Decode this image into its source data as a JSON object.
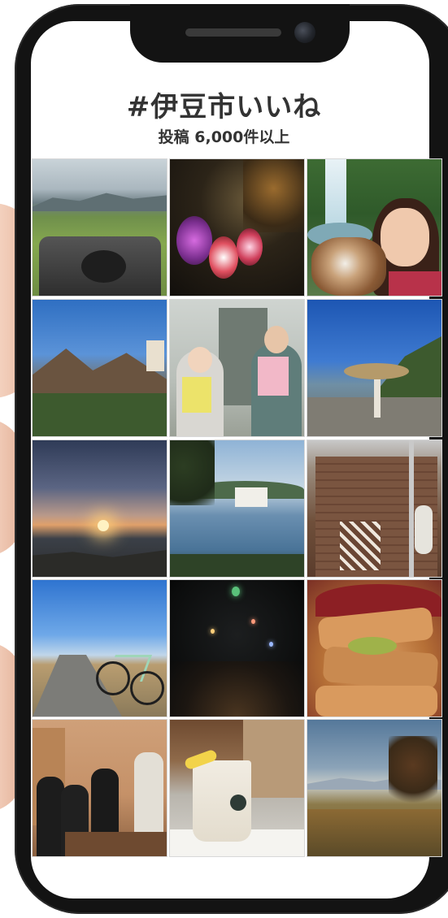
{
  "header": {
    "title": "#伊豆市いいね",
    "subtitle": "投稿 6,000件以上"
  },
  "grid": {
    "columns": 3,
    "rows": 5,
    "photos": [
      {
        "icon": "rice-field-photo"
      },
      {
        "icon": "night-lanterns-photo"
      },
      {
        "icon": "waterfall-woman-dog-photo"
      },
      {
        "icon": "rocky-hill-photo"
      },
      {
        "icon": "two-people-poster-photo"
      },
      {
        "icon": "blue-sky-structure-photo"
      },
      {
        "icon": "sunset-sea-photo"
      },
      {
        "icon": "bay-hotel-photo"
      },
      {
        "icon": "wooden-building-photo"
      },
      {
        "icon": "bicycle-road-photo"
      },
      {
        "icon": "floating-lanterns-photo"
      },
      {
        "icon": "katsu-bowl-photo"
      },
      {
        "icon": "office-meeting-photo"
      },
      {
        "icon": "drink-cup-photo"
      },
      {
        "icon": "autumn-hills-photo"
      }
    ]
  },
  "colors": {
    "phone_frame": "#131313",
    "screen_bg": "#ffffff",
    "text": "#333333"
  }
}
